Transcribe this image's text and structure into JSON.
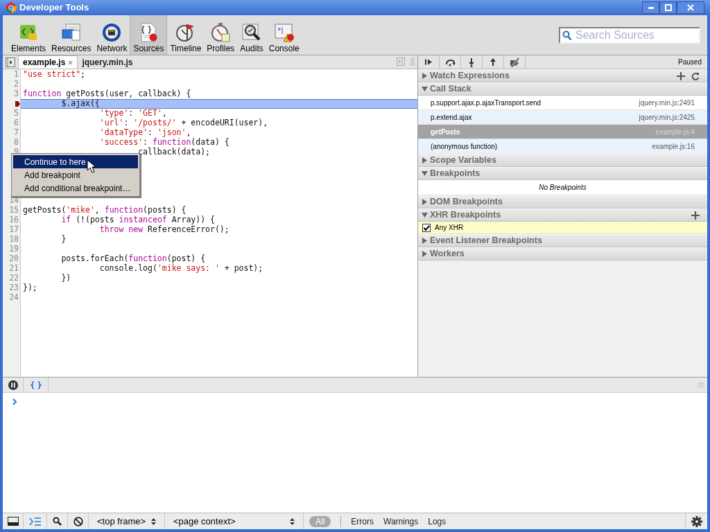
{
  "window": {
    "title": "Developer Tools"
  },
  "toolbar": {
    "panels": [
      {
        "label": "Elements",
        "selected": false
      },
      {
        "label": "Resources",
        "selected": false
      },
      {
        "label": "Network",
        "selected": false
      },
      {
        "label": "Sources",
        "selected": true
      },
      {
        "label": "Timeline",
        "selected": false
      },
      {
        "label": "Profiles",
        "selected": false
      },
      {
        "label": "Audits",
        "selected": false
      },
      {
        "label": "Console",
        "selected": false
      }
    ],
    "search": {
      "placeholder": "Search Sources"
    }
  },
  "editor": {
    "tabs": [
      {
        "label": "example.js",
        "selected": true
      },
      {
        "label": "jquery.min.js",
        "selected": false
      }
    ],
    "lines": [
      {
        "kind": "code",
        "number": "1",
        "tokens": [
          {
            "kind": "string",
            "text": "\"use strict\""
          },
          {
            "kind": "plain",
            "text": ";"
          }
        ]
      },
      {
        "kind": "code",
        "number": "2"
      },
      {
        "kind": "code",
        "number": "3",
        "tokens": [
          {
            "kind": "keyword",
            "text": "function"
          },
          {
            "kind": "plain",
            "text": " getPosts(user, callback) {"
          }
        ]
      },
      {
        "kind": "paused",
        "tokens": [
          {
            "kind": "plain",
            "text": "        $.ajax({"
          }
        ]
      },
      {
        "kind": "code",
        "number": "5",
        "tokens": [
          {
            "kind": "string",
            "text": "                'type'"
          },
          {
            "kind": "plain",
            "text": ": "
          },
          {
            "kind": "string",
            "text": "'GET'"
          },
          {
            "kind": "plain",
            "text": ","
          }
        ]
      },
      {
        "kind": "code",
        "number": "6",
        "tokens": [
          {
            "kind": "string",
            "text": "                'url'"
          },
          {
            "kind": "plain",
            "text": ": "
          },
          {
            "kind": "string",
            "text": "'/posts/'"
          },
          {
            "kind": "plain",
            "text": " + encodeURI(user),"
          }
        ]
      },
      {
        "kind": "code",
        "number": "7",
        "tokens": [
          {
            "kind": "string",
            "text": "                'dataType'"
          },
          {
            "kind": "plain",
            "text": ": "
          },
          {
            "kind": "string",
            "text": "'json'"
          },
          {
            "kind": "plain",
            "text": ","
          }
        ]
      },
      {
        "kind": "code",
        "number": "8",
        "tokens": [
          {
            "kind": "string",
            "text": "                'success'"
          },
          {
            "kind": "plain",
            "text": ": "
          },
          {
            "kind": "keyword",
            "text": "function"
          },
          {
            "kind": "plain",
            "text": "(data) {"
          }
        ]
      },
      {
        "kind": "code",
        "number": "9",
        "tokens": [
          {
            "kind": "plain",
            "text": "                        callback(data);"
          }
        ]
      },
      {
        "kind": "hidden"
      },
      {
        "kind": "hidden"
      },
      {
        "kind": "hidden"
      },
      {
        "kind": "hidden"
      },
      {
        "kind": "code",
        "number": "14"
      },
      {
        "kind": "code",
        "number": "15",
        "tokens": [
          {
            "kind": "plain",
            "text": "getPosts("
          },
          {
            "kind": "string",
            "text": "'mike'"
          },
          {
            "kind": "plain",
            "text": ", "
          },
          {
            "kind": "keyword",
            "text": "function"
          },
          {
            "kind": "plain",
            "text": "(posts) {"
          }
        ]
      },
      {
        "kind": "code",
        "number": "16",
        "tokens": [
          {
            "kind": "keyword",
            "text": "        if"
          },
          {
            "kind": "plain",
            "text": " (!(posts "
          },
          {
            "kind": "keyword",
            "text": "instanceof"
          },
          {
            "kind": "plain",
            "text": " Array)) {"
          }
        ]
      },
      {
        "kind": "code",
        "number": "17",
        "tokens": [
          {
            "kind": "keyword",
            "text": "                throw new"
          },
          {
            "kind": "plain",
            "text": " ReferenceError();"
          }
        ]
      },
      {
        "kind": "code",
        "number": "18",
        "tokens": [
          {
            "kind": "plain",
            "text": "        }"
          }
        ]
      },
      {
        "kind": "code",
        "number": "19"
      },
      {
        "kind": "code",
        "number": "20",
        "tokens": [
          {
            "kind": "plain",
            "text": "        posts.forEach("
          },
          {
            "kind": "keyword",
            "text": "function"
          },
          {
            "kind": "plain",
            "text": "(post) {"
          }
        ]
      },
      {
        "kind": "code",
        "number": "21",
        "tokens": [
          {
            "kind": "plain",
            "text": "                console.log("
          },
          {
            "kind": "string",
            "text": "'mike says: '"
          },
          {
            "kind": "plain",
            "text": " + post);"
          }
        ]
      },
      {
        "kind": "code",
        "number": "22",
        "tokens": [
          {
            "kind": "plain",
            "text": "        })"
          }
        ]
      },
      {
        "kind": "code",
        "number": "23",
        "tokens": [
          {
            "kind": "plain",
            "text": "});"
          }
        ]
      },
      {
        "kind": "code",
        "number": "24"
      }
    ],
    "context_menu": {
      "items": [
        {
          "label": "Continue to here",
          "selected": true
        },
        {
          "label": "Add breakpoint",
          "selected": false
        },
        {
          "label": "Add conditional breakpoint…",
          "selected": false
        }
      ]
    }
  },
  "debugger": {
    "status": "Paused",
    "sections": [
      {
        "title": "Watch Expressions",
        "expanded": false,
        "has_add": true,
        "has_refresh": true
      },
      {
        "title": "Call Stack",
        "expanded": true,
        "frames": [
          {
            "function": "p.support.ajax.p.ajaxTransport.send",
            "location": "jquery.min.js:2491",
            "selected": false
          },
          {
            "function": "p.extend.ajax",
            "location": "jquery.min.js:2425",
            "selected": false
          },
          {
            "function": "getPosts",
            "location": "example.js:4",
            "selected": true
          },
          {
            "function": "(anonymous function)",
            "location": "example.js:16",
            "selected": false
          }
        ]
      },
      {
        "title": "Scope Variables",
        "expanded": false
      },
      {
        "title": "Breakpoints",
        "expanded": true,
        "empty_text": "No Breakpoints"
      },
      {
        "title": "DOM Breakpoints",
        "expanded": false
      },
      {
        "title": "XHR Breakpoints",
        "expanded": true,
        "has_add": true,
        "items": [
          {
            "label": "Any XHR",
            "checked": true
          }
        ]
      },
      {
        "title": "Event Listener Breakpoints",
        "expanded": false
      },
      {
        "title": "Workers",
        "expanded": false
      }
    ]
  },
  "bottom_bar": {
    "frame_select": "<top frame>",
    "context_select": "<page context>",
    "filters": [
      {
        "label": "All",
        "selected": true
      },
      {
        "label": "Errors",
        "selected": false
      },
      {
        "label": "Warnings",
        "selected": false
      },
      {
        "label": "Logs",
        "selected": false
      }
    ]
  }
}
